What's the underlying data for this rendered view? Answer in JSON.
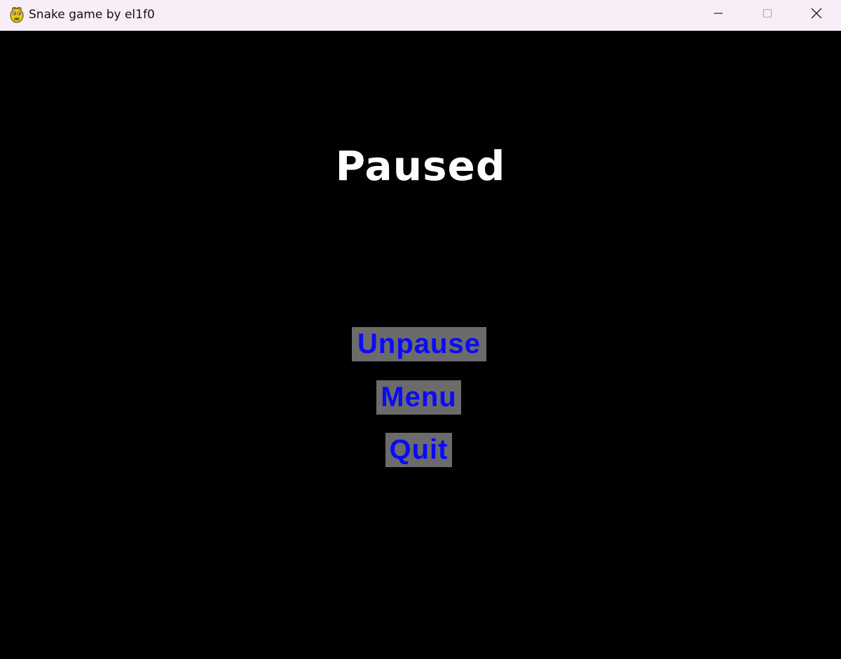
{
  "window": {
    "title": "Snake game by el1f0",
    "app_icon": "pygame-snake-icon",
    "controls": {
      "minimize_icon": "minimize-icon",
      "maximize_icon": "maximize-icon",
      "close_icon": "close-icon"
    }
  },
  "pause_screen": {
    "title": "Paused",
    "buttons": [
      {
        "label": "Unpause"
      },
      {
        "label": "Menu"
      },
      {
        "label": "Quit"
      }
    ]
  },
  "colors": {
    "background": "#000000",
    "title_text": "#ffffff",
    "button_background": "#6b6b6b",
    "button_text": "#0a0aff",
    "titlebar": "#f7eef8"
  }
}
